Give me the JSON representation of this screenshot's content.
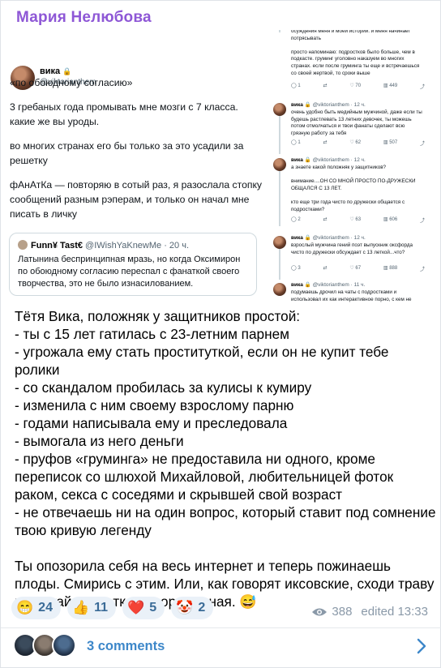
{
  "post": {
    "author": "Мария Нелюбова",
    "tweet_main": {
      "name": "вика",
      "lock_icon": "🔒",
      "handle": "@viktorianthem",
      "paragraphs": [
        "«по обоюдному согласию»",
        "3 гребаных года промывать мне мозги с 7 класса. какие же вы уроды.",
        "во многих странах его бы только за это усадили за решетку",
        "фАнАтКа — повторяю в сотый раз, я разослала стопку сообщений разным рэперам, и только он начал мне писать в личку"
      ],
      "quote": {
        "name": "Funn¥ Tast€",
        "handle": "@IWishYaKnewMe · 20 ч.",
        "text": "Латынина беспринципная мразь, но когда Оксимирон по обоюдному согласию переспал с фанаткой своего творчества, это не было изнасилованием."
      }
    },
    "tweet_thread": [
      {
        "head_name": "",
        "head_meta": "",
        "text": "осуждения меня и моей истории. и меня начинает потрясывать\n\nпросто напоминаю: подростков было больше, чем в подкасте. груминг уголовно наказуем во многих странах. если после груминга ты еще и встречаешься со своей жертвой, то сроки выше",
        "replies": "1",
        "retweets": "",
        "likes": "70",
        "views": "449"
      },
      {
        "head_name": "вика 🔒",
        "head_meta": "@viktorianthem · 12 ч.",
        "text": "очень удобно быть медийным мужчиной, даже если ты будешь растлевать 13 летних девочек, ты можешь потом отмолчаться и твои фанаты сделают всю грязную работу за тебя",
        "replies": "1",
        "retweets": "",
        "likes": "62",
        "views": "507"
      },
      {
        "head_name": "вика 🔒",
        "head_meta": "@viktorianthem · 12 ч.",
        "text": "а знаете какой положняк у защитников?\n\nвнимание....ОН СО МНОЙ ПРОСТО ПО-ДРУЖЕСКИ ОБЩАЛСЯ С 13 ЛЕТ.\n\nкто еще три года чисто по дружески общается с подростками?",
        "replies": "2",
        "retweets": "",
        "likes": "63",
        "views": "606"
      },
      {
        "head_name": "вика 🔒",
        "head_meta": "@viktorianthem · 12 ч.",
        "text": "взрослый мужчина гений поэт выпускник оксфорда чисто по дружески обсуждает с 13 леткой...что?",
        "replies": "3",
        "retweets": "",
        "likes": "67",
        "views": "888"
      },
      {
        "head_name": "вика 🔒",
        "head_meta": "@viktorianthem · 11 ч.",
        "text": "подумаешь дрочил на чаты с подростками и использовал их как интерактивное порно, с кем не",
        "replies": "",
        "retweets": "",
        "likes": "",
        "views": ""
      }
    ],
    "message_lines": [
      "Тётя Вика, положняк у защитников простой:",
      "- ты с 15 лет гатилась с 23-летним парнем",
      "- угрожала ему стать проституткой, если он не купит тебе ролики",
      "- со скандалом пробилась за кулисы к кумиру",
      "- изменила с ним своему взрослому парню",
      "- годами написывала ему и преследовала",
      "- вымогала из него деньги",
      "- пруфов «груминга» не предоставила ни одного, кроме переписок со шлюхой Михайловой, любительницей фоток раком, секса с соседями и скрывшей свой возраст",
      "- не отвечаешь ни на один вопрос, который ставит под сомнение твою кривую легенду",
      "",
      "Ты опозорила себя на весь интернет и теперь пожинаешь плоды. Смирись с этим. Или, как говорят иксовские, сходи траву потрогай. Фанатка ненормальная. 😅"
    ],
    "reactions": [
      {
        "emoji": "😁",
        "count": "24"
      },
      {
        "emoji": "👍",
        "count": "11"
      },
      {
        "emoji": "❤️",
        "count": "5"
      },
      {
        "emoji": "🤡",
        "count": "2"
      }
    ],
    "views": "388",
    "edited": "edited 13:33",
    "comments_label": "3 comments"
  },
  "colors": {
    "author": "#8e57d6",
    "link": "#3d87c9",
    "reaction_bg": "#eaf1f8"
  },
  "icons": [
    "lock-icon",
    "eye-icon",
    "chevron-right-icon",
    "reply-icon",
    "retweet-icon",
    "like-icon",
    "views-icon"
  ]
}
